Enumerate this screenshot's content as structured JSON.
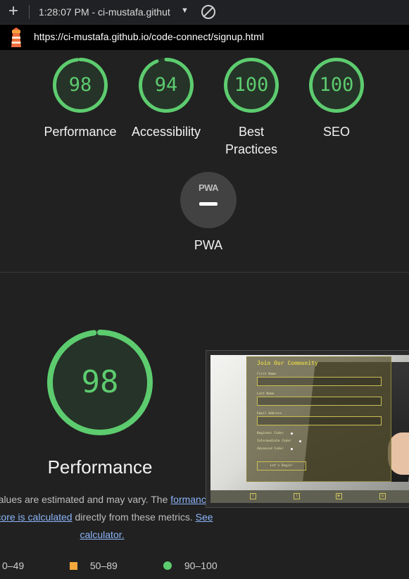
{
  "toolbar": {
    "tab_title": "1:28:07 PM - ci-mustafa.githut",
    "url": "https://ci-mustafa.github.io/code-connect/signup.html"
  },
  "gauges": [
    {
      "score": "98",
      "label": "Performance",
      "value": 98
    },
    {
      "score": "94",
      "label": "Accessibility",
      "value": 94
    },
    {
      "score": "100",
      "label": "Best Practices",
      "value": 100
    },
    {
      "score": "100",
      "label": "SEO",
      "value": 100
    }
  ],
  "pwa": {
    "badge": "PWA",
    "label": "PWA"
  },
  "performance": {
    "score": "98",
    "value": 98,
    "title": "Performance",
    "desc_part1": "Values are estimated and may vary. The ",
    "desc_link1": "formance score is calculated",
    "desc_part2": " directly from these metrics. ",
    "desc_link2": "See calculator."
  },
  "legend": {
    "fail": "0–49",
    "average": "50–89",
    "pass": "90–100"
  },
  "thumbnail": {
    "form_title": "Join Our Community",
    "first_name": "First Name",
    "last_name": "Last Name",
    "email": "Email Address",
    "beginner": "Beginner Coder",
    "intermediate": "Intermediate Coder",
    "advanced": "Advanced Coder",
    "submit": "Let's Begin!"
  },
  "colors": {
    "pass": "#5dcc6f",
    "average": "#f3a83b",
    "fail": "#ef5350",
    "link": "#8ab4f8"
  }
}
